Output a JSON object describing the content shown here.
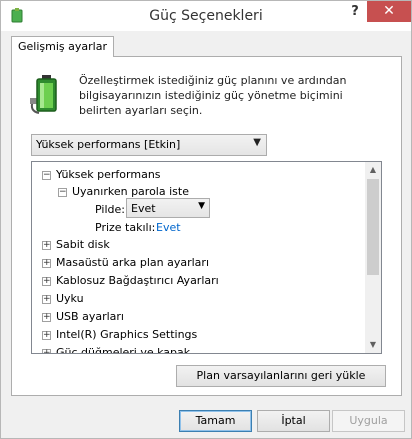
{
  "window": {
    "title": "Güç Seçenekleri",
    "help": "?",
    "close": "✕"
  },
  "tab": {
    "label": "Gelişmiş ayarlar"
  },
  "description": "Özelleştirmek istediğiniz güç planını ve ardından bilgisayarınızın istediğiniz güç yönetme biçimini belirten ayarları seçin.",
  "plan_select": {
    "value": "Yüksek performans [Etkin]"
  },
  "tree": {
    "root": "Yüksek performans",
    "child": "Uyanırken parola iste",
    "pilde_label": "Pilde:",
    "pilde_value": "Evet",
    "prize_label": "Prize takılı:",
    "prize_value": "Evet",
    "items": [
      "Sabit disk",
      "Masaüstü arka plan ayarları",
      "Kablosuz Bağdaştırıcı Ayarları",
      "Uyku",
      "USB ayarları",
      "Intel(R) Graphics Settings",
      "Güç düğmeleri ve kapak"
    ]
  },
  "restore_button": "Plan varsayılanlarını geri yükle",
  "buttons": {
    "ok": "Tamam",
    "cancel": "İptal",
    "apply": "Uygula"
  }
}
